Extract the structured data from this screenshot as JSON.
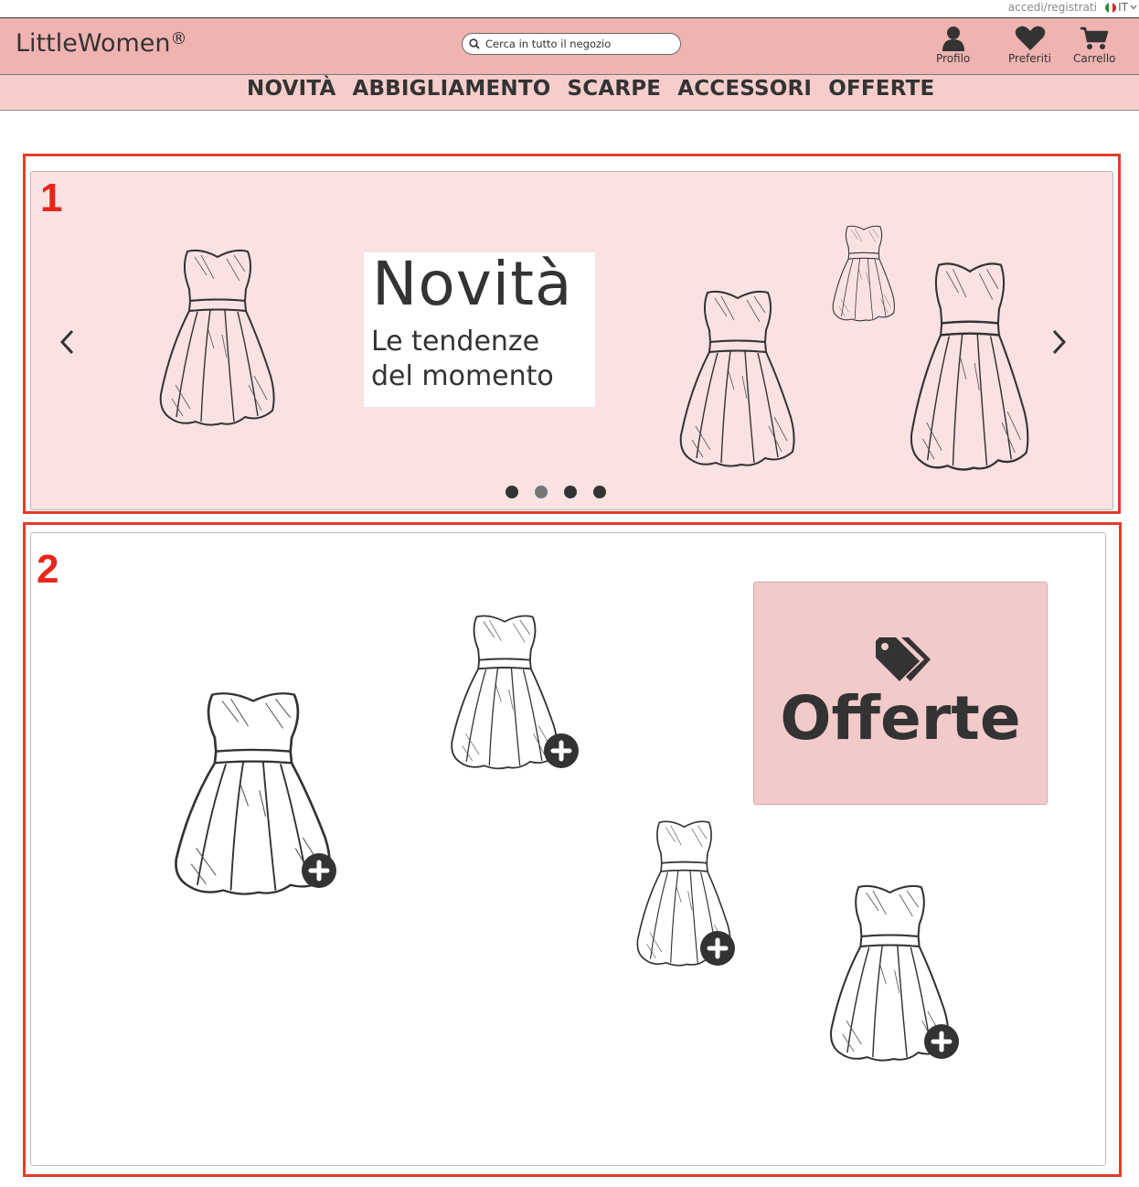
{
  "utility": {
    "login_label": "accedi/registrati",
    "lang_label": "IT"
  },
  "header": {
    "logo": "LittleWomen",
    "logo_mark": "®",
    "search_placeholder": "Cerca in tutto il negozio",
    "icons": [
      {
        "name": "user-icon",
        "label": "Profilo"
      },
      {
        "name": "heart-icon",
        "label": "Preferiti"
      },
      {
        "name": "cart-icon",
        "label": "Carrello"
      }
    ]
  },
  "nav": {
    "items": [
      "NOVITÀ",
      "ABBIGLIAMENTO",
      "SCARPE",
      "ACCESSORI",
      "OFFERTE"
    ]
  },
  "annotations": [
    "1",
    "2"
  ],
  "carousel": {
    "title": "Novità",
    "subtitle_line1": "Le tendenze",
    "subtitle_line2": "del momento",
    "slides": 4,
    "active_slide": 2
  },
  "products": {
    "offer_label": "Offerte"
  },
  "colors": {
    "header": "#efb3b2",
    "nav": "#f7cdcc",
    "carousel": "#fae1e2",
    "offer": "#f3caca",
    "annotation": "#e53b2a"
  }
}
